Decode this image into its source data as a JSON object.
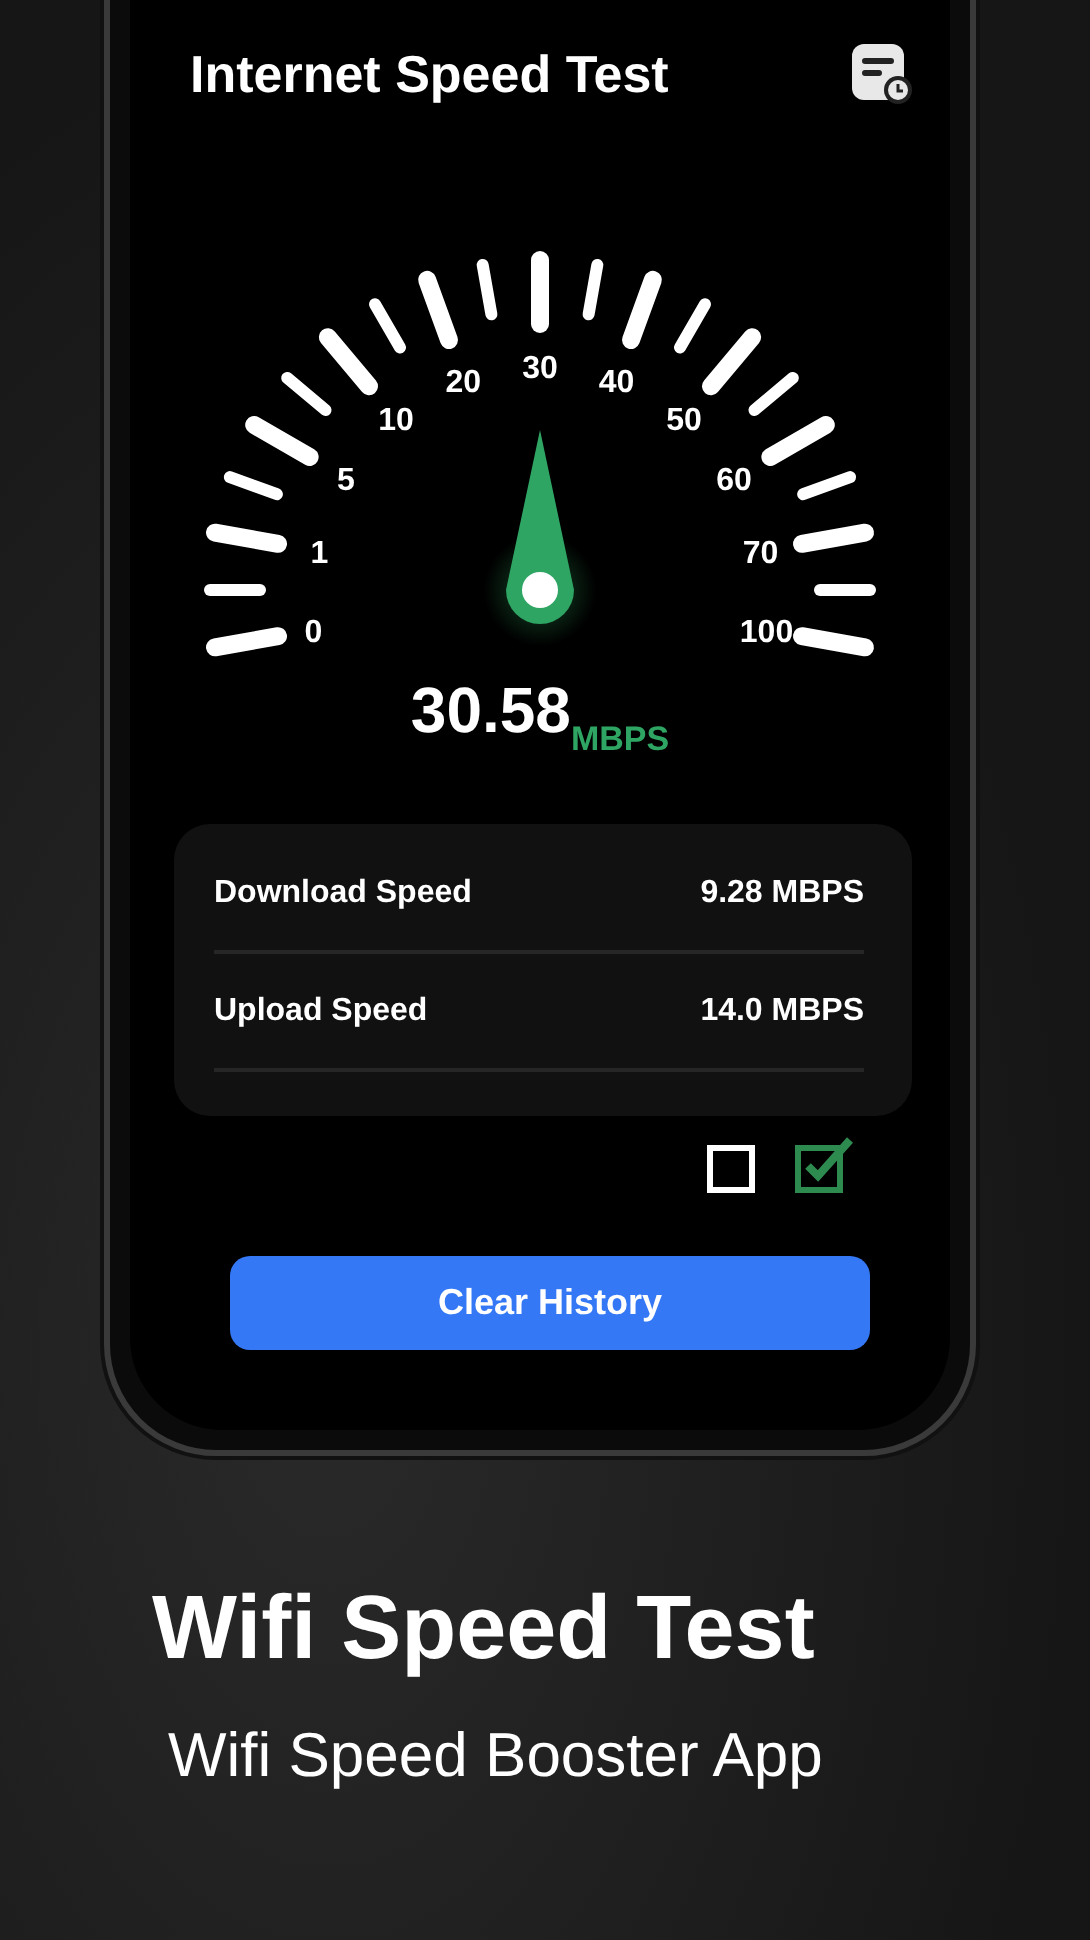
{
  "header": {
    "title": "Internet Speed Test"
  },
  "gauge": {
    "labels": [
      "0",
      "1",
      "5",
      "10",
      "20",
      "30",
      "40",
      "50",
      "60",
      "70",
      "100"
    ]
  },
  "speed": {
    "value": "30.58",
    "unit": "MBPS"
  },
  "results": [
    {
      "label": "Download Speed",
      "value": "9.28 MBPS"
    },
    {
      "label": "Upload Speed",
      "value": "14.0 MBPS"
    }
  ],
  "checkboxes": [
    {
      "checked": false
    },
    {
      "checked": true
    }
  ],
  "button": "Clear History",
  "promo": {
    "title": "Wifi Speed Test",
    "subtitle": "Wifi Speed Booster App"
  }
}
